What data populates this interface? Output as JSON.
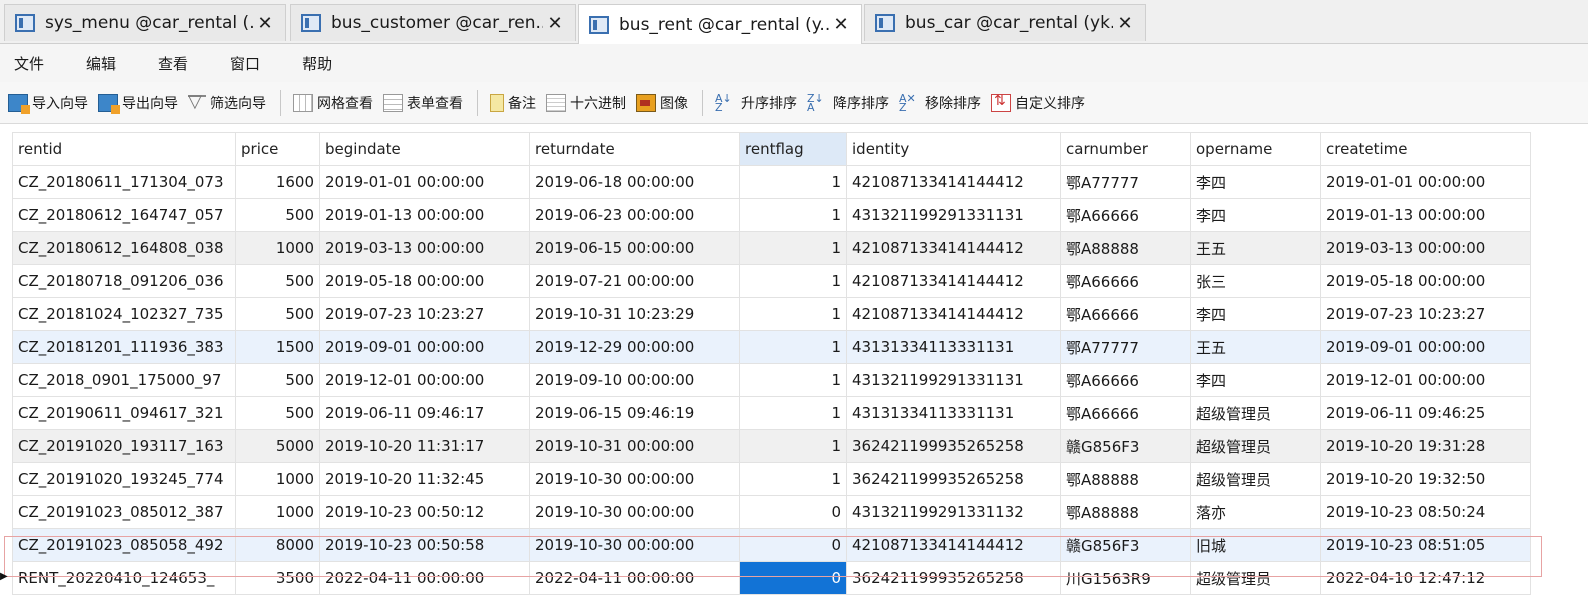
{
  "tabs": [
    {
      "label": "sys_menu @car_rental (...",
      "close": "✕"
    },
    {
      "label": "bus_customer @car_ren...",
      "close": "✕"
    },
    {
      "label": "bus_rent @car_rental (y...",
      "close": "✕"
    },
    {
      "label": "bus_car @car_rental (yk...",
      "close": "✕"
    }
  ],
  "menu": [
    "文件",
    "编辑",
    "查看",
    "窗口",
    "帮助"
  ],
  "toolbar": {
    "import": "导入向导",
    "export": "导出向导",
    "filter": "筛选向导",
    "grid_view": "网格查看",
    "form_view": "表单查看",
    "note": "备注",
    "hex": "十六进制",
    "image": "图像",
    "sort_asc": "升序排序",
    "sort_desc": "降序排序",
    "remove_sort": "移除排序",
    "custom_sort": "自定义排序"
  },
  "columns": [
    "rentid",
    "price",
    "begindate",
    "returndate",
    "rentflag",
    "identity",
    "carnumber",
    "opername",
    "createtime"
  ],
  "rows": [
    [
      "CZ_20180611_171304_073",
      "1600",
      "2019-01-01 00:00:00",
      "2019-06-18 00:00:00",
      "1",
      "421087133414144412",
      "鄂A77777",
      "李四",
      "2019-01-01 00:00:00"
    ],
    [
      "CZ_20180612_164747_057",
      "500",
      "2019-01-13 00:00:00",
      "2019-06-23 00:00:00",
      "1",
      "431321199291331131",
      "鄂A66666",
      "李四",
      "2019-01-13 00:00:00"
    ],
    [
      "CZ_20180612_164808_038",
      "1000",
      "2019-03-13 00:00:00",
      "2019-06-15 00:00:00",
      "1",
      "421087133414144412",
      "鄂A88888",
      "王五",
      "2019-03-13 00:00:00"
    ],
    [
      "CZ_20180718_091206_036",
      "500",
      "2019-05-18 00:00:00",
      "2019-07-21 00:00:00",
      "1",
      "421087133414144412",
      "鄂A66666",
      "张三",
      "2019-05-18 00:00:00"
    ],
    [
      "CZ_20181024_102327_735",
      "500",
      "2019-07-23 10:23:27",
      "2019-10-31 10:23:29",
      "1",
      "421087133414144412",
      "鄂A66666",
      "李四",
      "2019-07-23 10:23:27"
    ],
    [
      "CZ_20181201_111936_383",
      "1500",
      "2019-09-01 00:00:00",
      "2019-12-29 00:00:00",
      "1",
      "43131334113331131",
      "鄂A77777",
      "王五",
      "2019-09-01 00:00:00"
    ],
    [
      "CZ_2018_0901_175000_97",
      "500",
      "2019-12-01 00:00:00",
      "2019-09-10 00:00:00",
      "1",
      "431321199291331131",
      "鄂A66666",
      "李四",
      "2019-12-01 00:00:00"
    ],
    [
      "CZ_20190611_094617_321",
      "500",
      "2019-06-11 09:46:17",
      "2019-06-15 09:46:19",
      "1",
      "43131334113331131",
      "鄂A66666",
      "超级管理员",
      "2019-06-11 09:46:25"
    ],
    [
      "CZ_20191020_193117_163",
      "5000",
      "2019-10-20 11:31:17",
      "2019-10-31 00:00:00",
      "1",
      "362421199935265258",
      "赣G856F3",
      "超级管理员",
      "2019-10-20 19:31:28"
    ],
    [
      "CZ_20191020_193245_774",
      "1000",
      "2019-10-20 11:32:45",
      "2019-10-30 00:00:00",
      "1",
      "362421199935265258",
      "鄂A88888",
      "超级管理员",
      "2019-10-20 19:32:50"
    ],
    [
      "CZ_20191023_085012_387",
      "1000",
      "2019-10-23 00:50:12",
      "2019-10-30 00:00:00",
      "0",
      "431321199291331132",
      "鄂A88888",
      "落亦",
      "2019-10-23 08:50:24"
    ],
    [
      "CZ_20191023_085058_492",
      "8000",
      "2019-10-23 00:50:58",
      "2019-10-30 00:00:00",
      "0",
      "421087133414144412",
      "赣G856F3",
      "旧城",
      "2019-10-23 08:51:05"
    ],
    [
      "RENT_20220410_124653_",
      "3500",
      "2022-04-11 00:00:00",
      "2022-04-11 00:00:00",
      "0",
      "362421199935265258",
      "川G1563R9",
      "超级管理员",
      "2022-04-10 12:47:12"
    ]
  ],
  "current_row_marker": "▶",
  "colors": {
    "selection": "#1273d6",
    "selected_header": "#dde9f7",
    "alt_row": "#f0f0f0",
    "highlight_row": "#eaf2fc",
    "outline": "#e7a3a3"
  }
}
